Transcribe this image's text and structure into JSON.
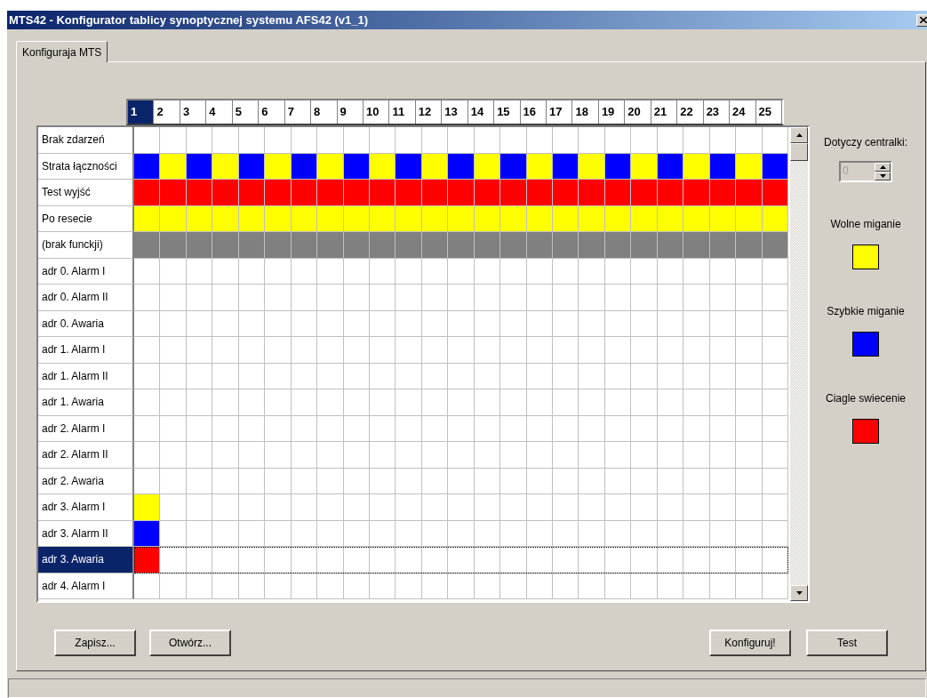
{
  "window": {
    "title": "MTS42 - Konfigurator tablicy synoptycznej systemu AFS42 (v1_1)"
  },
  "tabs": [
    {
      "label": "Konfiguraja MTS",
      "selected": true
    }
  ],
  "grid": {
    "columns": [
      {
        "label": "1",
        "selected": true
      },
      {
        "label": "2",
        "selected": false
      },
      {
        "label": "3",
        "selected": false
      },
      {
        "label": "4",
        "selected": false
      },
      {
        "label": "5",
        "selected": false
      },
      {
        "label": "6",
        "selected": false
      },
      {
        "label": "7",
        "selected": false
      },
      {
        "label": "8",
        "selected": false
      },
      {
        "label": "9",
        "selected": false
      },
      {
        "label": "10",
        "selected": false
      },
      {
        "label": "11",
        "selected": false
      },
      {
        "label": "12",
        "selected": false
      },
      {
        "label": "13",
        "selected": false
      },
      {
        "label": "14",
        "selected": false
      },
      {
        "label": "15",
        "selected": false
      },
      {
        "label": "16",
        "selected": false
      },
      {
        "label": "17",
        "selected": false
      },
      {
        "label": "18",
        "selected": false
      },
      {
        "label": "19",
        "selected": false
      },
      {
        "label": "20",
        "selected": false
      },
      {
        "label": "21",
        "selected": false
      },
      {
        "label": "22",
        "selected": false
      },
      {
        "label": "23",
        "selected": false
      },
      {
        "label": "24",
        "selected": false
      },
      {
        "label": "25",
        "selected": false
      }
    ],
    "rows": [
      {
        "label": "Brak zdarzeń",
        "selected": false,
        "cells": [
          {
            "color": "#ffffff"
          },
          {
            "color": "#ffffff"
          },
          {
            "color": "#ffffff"
          },
          {
            "color": "#ffffff"
          },
          {
            "color": "#ffffff"
          },
          {
            "color": "#ffffff"
          },
          {
            "color": "#ffffff"
          },
          {
            "color": "#ffffff"
          },
          {
            "color": "#ffffff"
          },
          {
            "color": "#ffffff"
          },
          {
            "color": "#ffffff"
          },
          {
            "color": "#ffffff"
          },
          {
            "color": "#ffffff"
          },
          {
            "color": "#ffffff"
          },
          {
            "color": "#ffffff"
          },
          {
            "color": "#ffffff"
          },
          {
            "color": "#ffffff"
          },
          {
            "color": "#ffffff"
          },
          {
            "color": "#ffffff"
          },
          {
            "color": "#ffffff"
          },
          {
            "color": "#ffffff"
          },
          {
            "color": "#ffffff"
          },
          {
            "color": "#ffffff"
          },
          {
            "color": "#ffffff"
          },
          {
            "color": "#ffffff"
          }
        ]
      },
      {
        "label": "Strata łączności",
        "selected": false,
        "cells": [
          {
            "color": "#0000ff"
          },
          {
            "color": "#ffff00"
          },
          {
            "color": "#0000ff"
          },
          {
            "color": "#ffff00"
          },
          {
            "color": "#0000ff"
          },
          {
            "color": "#ffff00"
          },
          {
            "color": "#0000ff"
          },
          {
            "color": "#ffff00"
          },
          {
            "color": "#0000ff"
          },
          {
            "color": "#ffff00"
          },
          {
            "color": "#0000ff"
          },
          {
            "color": "#ffff00"
          },
          {
            "color": "#0000ff"
          },
          {
            "color": "#ffff00"
          },
          {
            "color": "#0000ff"
          },
          {
            "color": "#ffff00"
          },
          {
            "color": "#0000ff"
          },
          {
            "color": "#ffff00"
          },
          {
            "color": "#0000ff"
          },
          {
            "color": "#ffff00"
          },
          {
            "color": "#0000ff"
          },
          {
            "color": "#ffff00"
          },
          {
            "color": "#0000ff"
          },
          {
            "color": "#ffff00"
          },
          {
            "color": "#0000ff"
          }
        ]
      },
      {
        "label": "Test wyjść",
        "selected": false,
        "cells": [
          {
            "color": "#ff0000"
          },
          {
            "color": "#ff0000"
          },
          {
            "color": "#ff0000"
          },
          {
            "color": "#ff0000"
          },
          {
            "color": "#ff0000"
          },
          {
            "color": "#ff0000"
          },
          {
            "color": "#ff0000"
          },
          {
            "color": "#ff0000"
          },
          {
            "color": "#ff0000"
          },
          {
            "color": "#ff0000"
          },
          {
            "color": "#ff0000"
          },
          {
            "color": "#ff0000"
          },
          {
            "color": "#ff0000"
          },
          {
            "color": "#ff0000"
          },
          {
            "color": "#ff0000"
          },
          {
            "color": "#ff0000"
          },
          {
            "color": "#ff0000"
          },
          {
            "color": "#ff0000"
          },
          {
            "color": "#ff0000"
          },
          {
            "color": "#ff0000"
          },
          {
            "color": "#ff0000"
          },
          {
            "color": "#ff0000"
          },
          {
            "color": "#ff0000"
          },
          {
            "color": "#ff0000"
          },
          {
            "color": "#ff0000"
          }
        ]
      },
      {
        "label": "Po resecie",
        "selected": false,
        "cells": [
          {
            "color": "#ffff00"
          },
          {
            "color": "#ffff00"
          },
          {
            "color": "#ffff00"
          },
          {
            "color": "#ffff00"
          },
          {
            "color": "#ffff00"
          },
          {
            "color": "#ffff00"
          },
          {
            "color": "#ffff00"
          },
          {
            "color": "#ffff00"
          },
          {
            "color": "#ffff00"
          },
          {
            "color": "#ffff00"
          },
          {
            "color": "#ffff00"
          },
          {
            "color": "#ffff00"
          },
          {
            "color": "#ffff00"
          },
          {
            "color": "#ffff00"
          },
          {
            "color": "#ffff00"
          },
          {
            "color": "#ffff00"
          },
          {
            "color": "#ffff00"
          },
          {
            "color": "#ffff00"
          },
          {
            "color": "#ffff00"
          },
          {
            "color": "#ffff00"
          },
          {
            "color": "#ffff00"
          },
          {
            "color": "#ffff00"
          },
          {
            "color": "#ffff00"
          },
          {
            "color": "#ffff00"
          },
          {
            "color": "#ffff00"
          }
        ]
      },
      {
        "label": "(brak funckji)",
        "selected": false,
        "cells": [
          {
            "color": "#808080"
          },
          {
            "color": "#808080"
          },
          {
            "color": "#808080"
          },
          {
            "color": "#808080"
          },
          {
            "color": "#808080"
          },
          {
            "color": "#808080"
          },
          {
            "color": "#808080"
          },
          {
            "color": "#808080"
          },
          {
            "color": "#808080"
          },
          {
            "color": "#808080"
          },
          {
            "color": "#808080"
          },
          {
            "color": "#808080"
          },
          {
            "color": "#808080"
          },
          {
            "color": "#808080"
          },
          {
            "color": "#808080"
          },
          {
            "color": "#808080"
          },
          {
            "color": "#808080"
          },
          {
            "color": "#808080"
          },
          {
            "color": "#808080"
          },
          {
            "color": "#808080"
          },
          {
            "color": "#808080"
          },
          {
            "color": "#808080"
          },
          {
            "color": "#808080"
          },
          {
            "color": "#808080"
          },
          {
            "color": "#808080"
          }
        ]
      },
      {
        "label": "adr 0. Alarm I",
        "selected": false,
        "cells": [
          {
            "color": "#ffffff"
          },
          {
            "color": "#ffffff"
          },
          {
            "color": "#ffffff"
          },
          {
            "color": "#ffffff"
          },
          {
            "color": "#ffffff"
          },
          {
            "color": "#ffffff"
          },
          {
            "color": "#ffffff"
          },
          {
            "color": "#ffffff"
          },
          {
            "color": "#ffffff"
          },
          {
            "color": "#ffffff"
          },
          {
            "color": "#ffffff"
          },
          {
            "color": "#ffffff"
          },
          {
            "color": "#ffffff"
          },
          {
            "color": "#ffffff"
          },
          {
            "color": "#ffffff"
          },
          {
            "color": "#ffffff"
          },
          {
            "color": "#ffffff"
          },
          {
            "color": "#ffffff"
          },
          {
            "color": "#ffffff"
          },
          {
            "color": "#ffffff"
          },
          {
            "color": "#ffffff"
          },
          {
            "color": "#ffffff"
          },
          {
            "color": "#ffffff"
          },
          {
            "color": "#ffffff"
          },
          {
            "color": "#ffffff"
          }
        ]
      },
      {
        "label": "adr 0. Alarm II",
        "selected": false,
        "cells": [
          {
            "color": "#ffffff"
          },
          {
            "color": "#ffffff"
          },
          {
            "color": "#ffffff"
          },
          {
            "color": "#ffffff"
          },
          {
            "color": "#ffffff"
          },
          {
            "color": "#ffffff"
          },
          {
            "color": "#ffffff"
          },
          {
            "color": "#ffffff"
          },
          {
            "color": "#ffffff"
          },
          {
            "color": "#ffffff"
          },
          {
            "color": "#ffffff"
          },
          {
            "color": "#ffffff"
          },
          {
            "color": "#ffffff"
          },
          {
            "color": "#ffffff"
          },
          {
            "color": "#ffffff"
          },
          {
            "color": "#ffffff"
          },
          {
            "color": "#ffffff"
          },
          {
            "color": "#ffffff"
          },
          {
            "color": "#ffffff"
          },
          {
            "color": "#ffffff"
          },
          {
            "color": "#ffffff"
          },
          {
            "color": "#ffffff"
          },
          {
            "color": "#ffffff"
          },
          {
            "color": "#ffffff"
          },
          {
            "color": "#ffffff"
          }
        ]
      },
      {
        "label": "adr 0. Awaria",
        "selected": false,
        "cells": [
          {
            "color": "#ffffff"
          },
          {
            "color": "#ffffff"
          },
          {
            "color": "#ffffff"
          },
          {
            "color": "#ffffff"
          },
          {
            "color": "#ffffff"
          },
          {
            "color": "#ffffff"
          },
          {
            "color": "#ffffff"
          },
          {
            "color": "#ffffff"
          },
          {
            "color": "#ffffff"
          },
          {
            "color": "#ffffff"
          },
          {
            "color": "#ffffff"
          },
          {
            "color": "#ffffff"
          },
          {
            "color": "#ffffff"
          },
          {
            "color": "#ffffff"
          },
          {
            "color": "#ffffff"
          },
          {
            "color": "#ffffff"
          },
          {
            "color": "#ffffff"
          },
          {
            "color": "#ffffff"
          },
          {
            "color": "#ffffff"
          },
          {
            "color": "#ffffff"
          },
          {
            "color": "#ffffff"
          },
          {
            "color": "#ffffff"
          },
          {
            "color": "#ffffff"
          },
          {
            "color": "#ffffff"
          },
          {
            "color": "#ffffff"
          }
        ]
      },
      {
        "label": "adr 1. Alarm I",
        "selected": false,
        "cells": [
          {
            "color": "#ffffff"
          },
          {
            "color": "#ffffff"
          },
          {
            "color": "#ffffff"
          },
          {
            "color": "#ffffff"
          },
          {
            "color": "#ffffff"
          },
          {
            "color": "#ffffff"
          },
          {
            "color": "#ffffff"
          },
          {
            "color": "#ffffff"
          },
          {
            "color": "#ffffff"
          },
          {
            "color": "#ffffff"
          },
          {
            "color": "#ffffff"
          },
          {
            "color": "#ffffff"
          },
          {
            "color": "#ffffff"
          },
          {
            "color": "#ffffff"
          },
          {
            "color": "#ffffff"
          },
          {
            "color": "#ffffff"
          },
          {
            "color": "#ffffff"
          },
          {
            "color": "#ffffff"
          },
          {
            "color": "#ffffff"
          },
          {
            "color": "#ffffff"
          },
          {
            "color": "#ffffff"
          },
          {
            "color": "#ffffff"
          },
          {
            "color": "#ffffff"
          },
          {
            "color": "#ffffff"
          },
          {
            "color": "#ffffff"
          }
        ]
      },
      {
        "label": "adr 1. Alarm II",
        "selected": false,
        "cells": [
          {
            "color": "#ffffff"
          },
          {
            "color": "#ffffff"
          },
          {
            "color": "#ffffff"
          },
          {
            "color": "#ffffff"
          },
          {
            "color": "#ffffff"
          },
          {
            "color": "#ffffff"
          },
          {
            "color": "#ffffff"
          },
          {
            "color": "#ffffff"
          },
          {
            "color": "#ffffff"
          },
          {
            "color": "#ffffff"
          },
          {
            "color": "#ffffff"
          },
          {
            "color": "#ffffff"
          },
          {
            "color": "#ffffff"
          },
          {
            "color": "#ffffff"
          },
          {
            "color": "#ffffff"
          },
          {
            "color": "#ffffff"
          },
          {
            "color": "#ffffff"
          },
          {
            "color": "#ffffff"
          },
          {
            "color": "#ffffff"
          },
          {
            "color": "#ffffff"
          },
          {
            "color": "#ffffff"
          },
          {
            "color": "#ffffff"
          },
          {
            "color": "#ffffff"
          },
          {
            "color": "#ffffff"
          },
          {
            "color": "#ffffff"
          }
        ]
      },
      {
        "label": "adr 1. Awaria",
        "selected": false,
        "cells": [
          {
            "color": "#ffffff"
          },
          {
            "color": "#ffffff"
          },
          {
            "color": "#ffffff"
          },
          {
            "color": "#ffffff"
          },
          {
            "color": "#ffffff"
          },
          {
            "color": "#ffffff"
          },
          {
            "color": "#ffffff"
          },
          {
            "color": "#ffffff"
          },
          {
            "color": "#ffffff"
          },
          {
            "color": "#ffffff"
          },
          {
            "color": "#ffffff"
          },
          {
            "color": "#ffffff"
          },
          {
            "color": "#ffffff"
          },
          {
            "color": "#ffffff"
          },
          {
            "color": "#ffffff"
          },
          {
            "color": "#ffffff"
          },
          {
            "color": "#ffffff"
          },
          {
            "color": "#ffffff"
          },
          {
            "color": "#ffffff"
          },
          {
            "color": "#ffffff"
          },
          {
            "color": "#ffffff"
          },
          {
            "color": "#ffffff"
          },
          {
            "color": "#ffffff"
          },
          {
            "color": "#ffffff"
          },
          {
            "color": "#ffffff"
          }
        ]
      },
      {
        "label": "adr 2. Alarm I",
        "selected": false,
        "cells": [
          {
            "color": "#ffffff"
          },
          {
            "color": "#ffffff"
          },
          {
            "color": "#ffffff"
          },
          {
            "color": "#ffffff"
          },
          {
            "color": "#ffffff"
          },
          {
            "color": "#ffffff"
          },
          {
            "color": "#ffffff"
          },
          {
            "color": "#ffffff"
          },
          {
            "color": "#ffffff"
          },
          {
            "color": "#ffffff"
          },
          {
            "color": "#ffffff"
          },
          {
            "color": "#ffffff"
          },
          {
            "color": "#ffffff"
          },
          {
            "color": "#ffffff"
          },
          {
            "color": "#ffffff"
          },
          {
            "color": "#ffffff"
          },
          {
            "color": "#ffffff"
          },
          {
            "color": "#ffffff"
          },
          {
            "color": "#ffffff"
          },
          {
            "color": "#ffffff"
          },
          {
            "color": "#ffffff"
          },
          {
            "color": "#ffffff"
          },
          {
            "color": "#ffffff"
          },
          {
            "color": "#ffffff"
          },
          {
            "color": "#ffffff"
          }
        ]
      },
      {
        "label": "adr 2. Alarm II",
        "selected": false,
        "cells": [
          {
            "color": "#ffffff"
          },
          {
            "color": "#ffffff"
          },
          {
            "color": "#ffffff"
          },
          {
            "color": "#ffffff"
          },
          {
            "color": "#ffffff"
          },
          {
            "color": "#ffffff"
          },
          {
            "color": "#ffffff"
          },
          {
            "color": "#ffffff"
          },
          {
            "color": "#ffffff"
          },
          {
            "color": "#ffffff"
          },
          {
            "color": "#ffffff"
          },
          {
            "color": "#ffffff"
          },
          {
            "color": "#ffffff"
          },
          {
            "color": "#ffffff"
          },
          {
            "color": "#ffffff"
          },
          {
            "color": "#ffffff"
          },
          {
            "color": "#ffffff"
          },
          {
            "color": "#ffffff"
          },
          {
            "color": "#ffffff"
          },
          {
            "color": "#ffffff"
          },
          {
            "color": "#ffffff"
          },
          {
            "color": "#ffffff"
          },
          {
            "color": "#ffffff"
          },
          {
            "color": "#ffffff"
          },
          {
            "color": "#ffffff"
          }
        ]
      },
      {
        "label": "adr 2. Awaria",
        "selected": false,
        "cells": [
          {
            "color": "#ffffff"
          },
          {
            "color": "#ffffff"
          },
          {
            "color": "#ffffff"
          },
          {
            "color": "#ffffff"
          },
          {
            "color": "#ffffff"
          },
          {
            "color": "#ffffff"
          },
          {
            "color": "#ffffff"
          },
          {
            "color": "#ffffff"
          },
          {
            "color": "#ffffff"
          },
          {
            "color": "#ffffff"
          },
          {
            "color": "#ffffff"
          },
          {
            "color": "#ffffff"
          },
          {
            "color": "#ffffff"
          },
          {
            "color": "#ffffff"
          },
          {
            "color": "#ffffff"
          },
          {
            "color": "#ffffff"
          },
          {
            "color": "#ffffff"
          },
          {
            "color": "#ffffff"
          },
          {
            "color": "#ffffff"
          },
          {
            "color": "#ffffff"
          },
          {
            "color": "#ffffff"
          },
          {
            "color": "#ffffff"
          },
          {
            "color": "#ffffff"
          },
          {
            "color": "#ffffff"
          },
          {
            "color": "#ffffff"
          }
        ]
      },
      {
        "label": "adr 3. Alarm I",
        "selected": false,
        "cells": [
          {
            "color": "#ffff00"
          },
          {
            "color": "#ffffff"
          },
          {
            "color": "#ffffff"
          },
          {
            "color": "#ffffff"
          },
          {
            "color": "#ffffff"
          },
          {
            "color": "#ffffff"
          },
          {
            "color": "#ffffff"
          },
          {
            "color": "#ffffff"
          },
          {
            "color": "#ffffff"
          },
          {
            "color": "#ffffff"
          },
          {
            "color": "#ffffff"
          },
          {
            "color": "#ffffff"
          },
          {
            "color": "#ffffff"
          },
          {
            "color": "#ffffff"
          },
          {
            "color": "#ffffff"
          },
          {
            "color": "#ffffff"
          },
          {
            "color": "#ffffff"
          },
          {
            "color": "#ffffff"
          },
          {
            "color": "#ffffff"
          },
          {
            "color": "#ffffff"
          },
          {
            "color": "#ffffff"
          },
          {
            "color": "#ffffff"
          },
          {
            "color": "#ffffff"
          },
          {
            "color": "#ffffff"
          },
          {
            "color": "#ffffff"
          }
        ]
      },
      {
        "label": "adr 3. Alarm II",
        "selected": false,
        "cells": [
          {
            "color": "#0000ff"
          },
          {
            "color": "#ffffff"
          },
          {
            "color": "#ffffff"
          },
          {
            "color": "#ffffff"
          },
          {
            "color": "#ffffff"
          },
          {
            "color": "#ffffff"
          },
          {
            "color": "#ffffff"
          },
          {
            "color": "#ffffff"
          },
          {
            "color": "#ffffff"
          },
          {
            "color": "#ffffff"
          },
          {
            "color": "#ffffff"
          },
          {
            "color": "#ffffff"
          },
          {
            "color": "#ffffff"
          },
          {
            "color": "#ffffff"
          },
          {
            "color": "#ffffff"
          },
          {
            "color": "#ffffff"
          },
          {
            "color": "#ffffff"
          },
          {
            "color": "#ffffff"
          },
          {
            "color": "#ffffff"
          },
          {
            "color": "#ffffff"
          },
          {
            "color": "#ffffff"
          },
          {
            "color": "#ffffff"
          },
          {
            "color": "#ffffff"
          },
          {
            "color": "#ffffff"
          },
          {
            "color": "#ffffff"
          }
        ]
      },
      {
        "label": "adr 3. Awaria",
        "selected": true,
        "cells": [
          {
            "color": "#ff0000"
          },
          {
            "color": "#ffffff"
          },
          {
            "color": "#ffffff"
          },
          {
            "color": "#ffffff"
          },
          {
            "color": "#ffffff"
          },
          {
            "color": "#ffffff"
          },
          {
            "color": "#ffffff"
          },
          {
            "color": "#ffffff"
          },
          {
            "color": "#ffffff"
          },
          {
            "color": "#ffffff"
          },
          {
            "color": "#ffffff"
          },
          {
            "color": "#ffffff"
          },
          {
            "color": "#ffffff"
          },
          {
            "color": "#ffffff"
          },
          {
            "color": "#ffffff"
          },
          {
            "color": "#ffffff"
          },
          {
            "color": "#ffffff"
          },
          {
            "color": "#ffffff"
          },
          {
            "color": "#ffffff"
          },
          {
            "color": "#ffffff"
          },
          {
            "color": "#ffffff"
          },
          {
            "color": "#ffffff"
          },
          {
            "color": "#ffffff"
          },
          {
            "color": "#ffffff"
          },
          {
            "color": "#ffffff"
          }
        ]
      },
      {
        "label": "adr 4. Alarm I",
        "selected": false,
        "cells": [
          {
            "color": "#ffffff"
          },
          {
            "color": "#ffffff"
          },
          {
            "color": "#ffffff"
          },
          {
            "color": "#ffffff"
          },
          {
            "color": "#ffffff"
          },
          {
            "color": "#ffffff"
          },
          {
            "color": "#ffffff"
          },
          {
            "color": "#ffffff"
          },
          {
            "color": "#ffffff"
          },
          {
            "color": "#ffffff"
          },
          {
            "color": "#ffffff"
          },
          {
            "color": "#ffffff"
          },
          {
            "color": "#ffffff"
          },
          {
            "color": "#ffffff"
          },
          {
            "color": "#ffffff"
          },
          {
            "color": "#ffffff"
          },
          {
            "color": "#ffffff"
          },
          {
            "color": "#ffffff"
          },
          {
            "color": "#ffffff"
          },
          {
            "color": "#ffffff"
          },
          {
            "color": "#ffffff"
          },
          {
            "color": "#ffffff"
          },
          {
            "color": "#ffffff"
          },
          {
            "color": "#ffffff"
          },
          {
            "color": "#ffffff"
          }
        ]
      }
    ]
  },
  "side_panel": {
    "label": "Dotyczy centralki:",
    "spinner": {
      "value": "0",
      "disabled": true
    },
    "legend": [
      {
        "label": "Wolne miganie",
        "color": "#ffff00"
      },
      {
        "label": "Szybkie miganie",
        "color": "#0000ff"
      },
      {
        "label": "Ciagle swiecenie",
        "color": "#ff0000"
      }
    ]
  },
  "buttons_left": [
    "Zapisz...",
    "Otwórz..."
  ],
  "buttons_right": [
    "Konfiguruj!",
    "Test"
  ]
}
